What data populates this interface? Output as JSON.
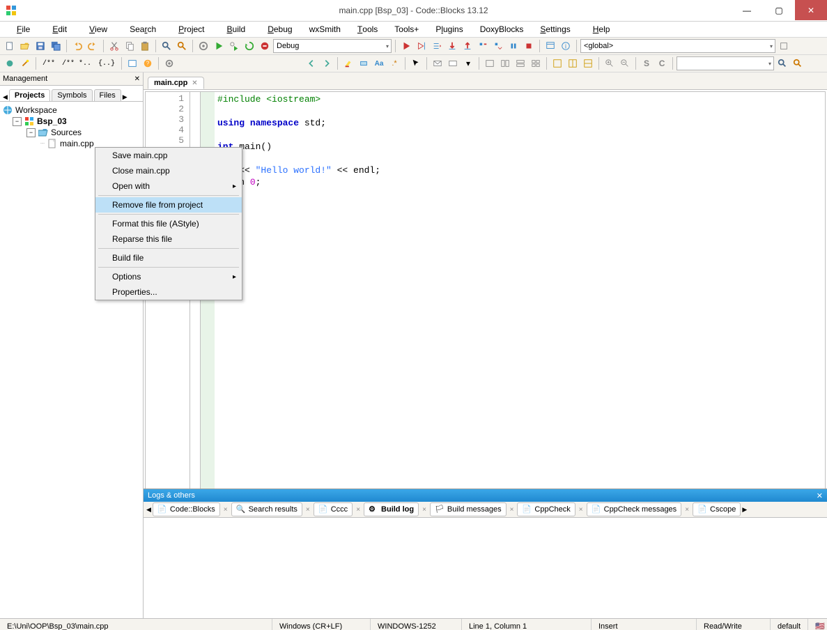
{
  "window": {
    "title": "main.cpp [Bsp_03] - Code::Blocks 13.12"
  },
  "menu": {
    "file": "File",
    "edit": "Edit",
    "view": "View",
    "search": "Search",
    "project": "Project",
    "build": "Build",
    "debug": "Debug",
    "wxsmith": "wxSmith",
    "tools": "Tools",
    "toolsplus": "Tools+",
    "plugins": "Plugins",
    "doxyblocks": "DoxyBlocks",
    "settings": "Settings",
    "help": "Help"
  },
  "toolbar": {
    "conf": "Debug",
    "target": "<global>",
    "slash": "/**",
    "star": "/** *..",
    "brkt": "{..}"
  },
  "mgmt": {
    "title": "Management",
    "tabs": {
      "projects": "Projects",
      "symbols": "Symbols",
      "files": "Files"
    },
    "tree": {
      "workspace": "Workspace",
      "project": "Bsp_03",
      "sources": "Sources",
      "file": "main.cpp"
    }
  },
  "editor": {
    "tab": "main.cpp",
    "lines": {
      "1": "1",
      "2": "2",
      "3": "3",
      "4": "4",
      "5": "5"
    },
    "code": {
      "l1a": "#include ",
      "l1b": "<iostream>",
      "l3a": "using",
      "l3b": " namespace",
      "l3c": " std;",
      "l5a": "int",
      "l5b": " main()",
      "l7a": "out << ",
      "l7b": "\"Hello world!\"",
      "l7c": " << endl;",
      "l8a": "eturn ",
      "l8b": "0",
      "l8c": ";"
    }
  },
  "context": {
    "save": "Save main.cpp",
    "close": "Close main.cpp",
    "open_with": "Open with",
    "remove": "Remove file from project",
    "format": "Format this file (AStyle)",
    "reparse": "Reparse this file",
    "build": "Build file",
    "options": "Options",
    "properties": "Properties..."
  },
  "logs": {
    "title": "Logs & others",
    "tabs": {
      "codeblocks": "Code::Blocks",
      "search": "Search results",
      "cccc": "Cccc",
      "buildlog": "Build log",
      "buildmsg": "Build messages",
      "cppcheck": "CppCheck",
      "cppcheckmsg": "CppCheck messages",
      "cscope": "Cscope"
    }
  },
  "status": {
    "path": "E:\\Uni\\OOP\\Bsp_03\\main.cpp",
    "eol": "Windows (CR+LF)",
    "enc": "WINDOWS-1252",
    "pos": "Line 1, Column 1",
    "ins": "Insert",
    "rw": "Read/Write",
    "prof": "default"
  }
}
